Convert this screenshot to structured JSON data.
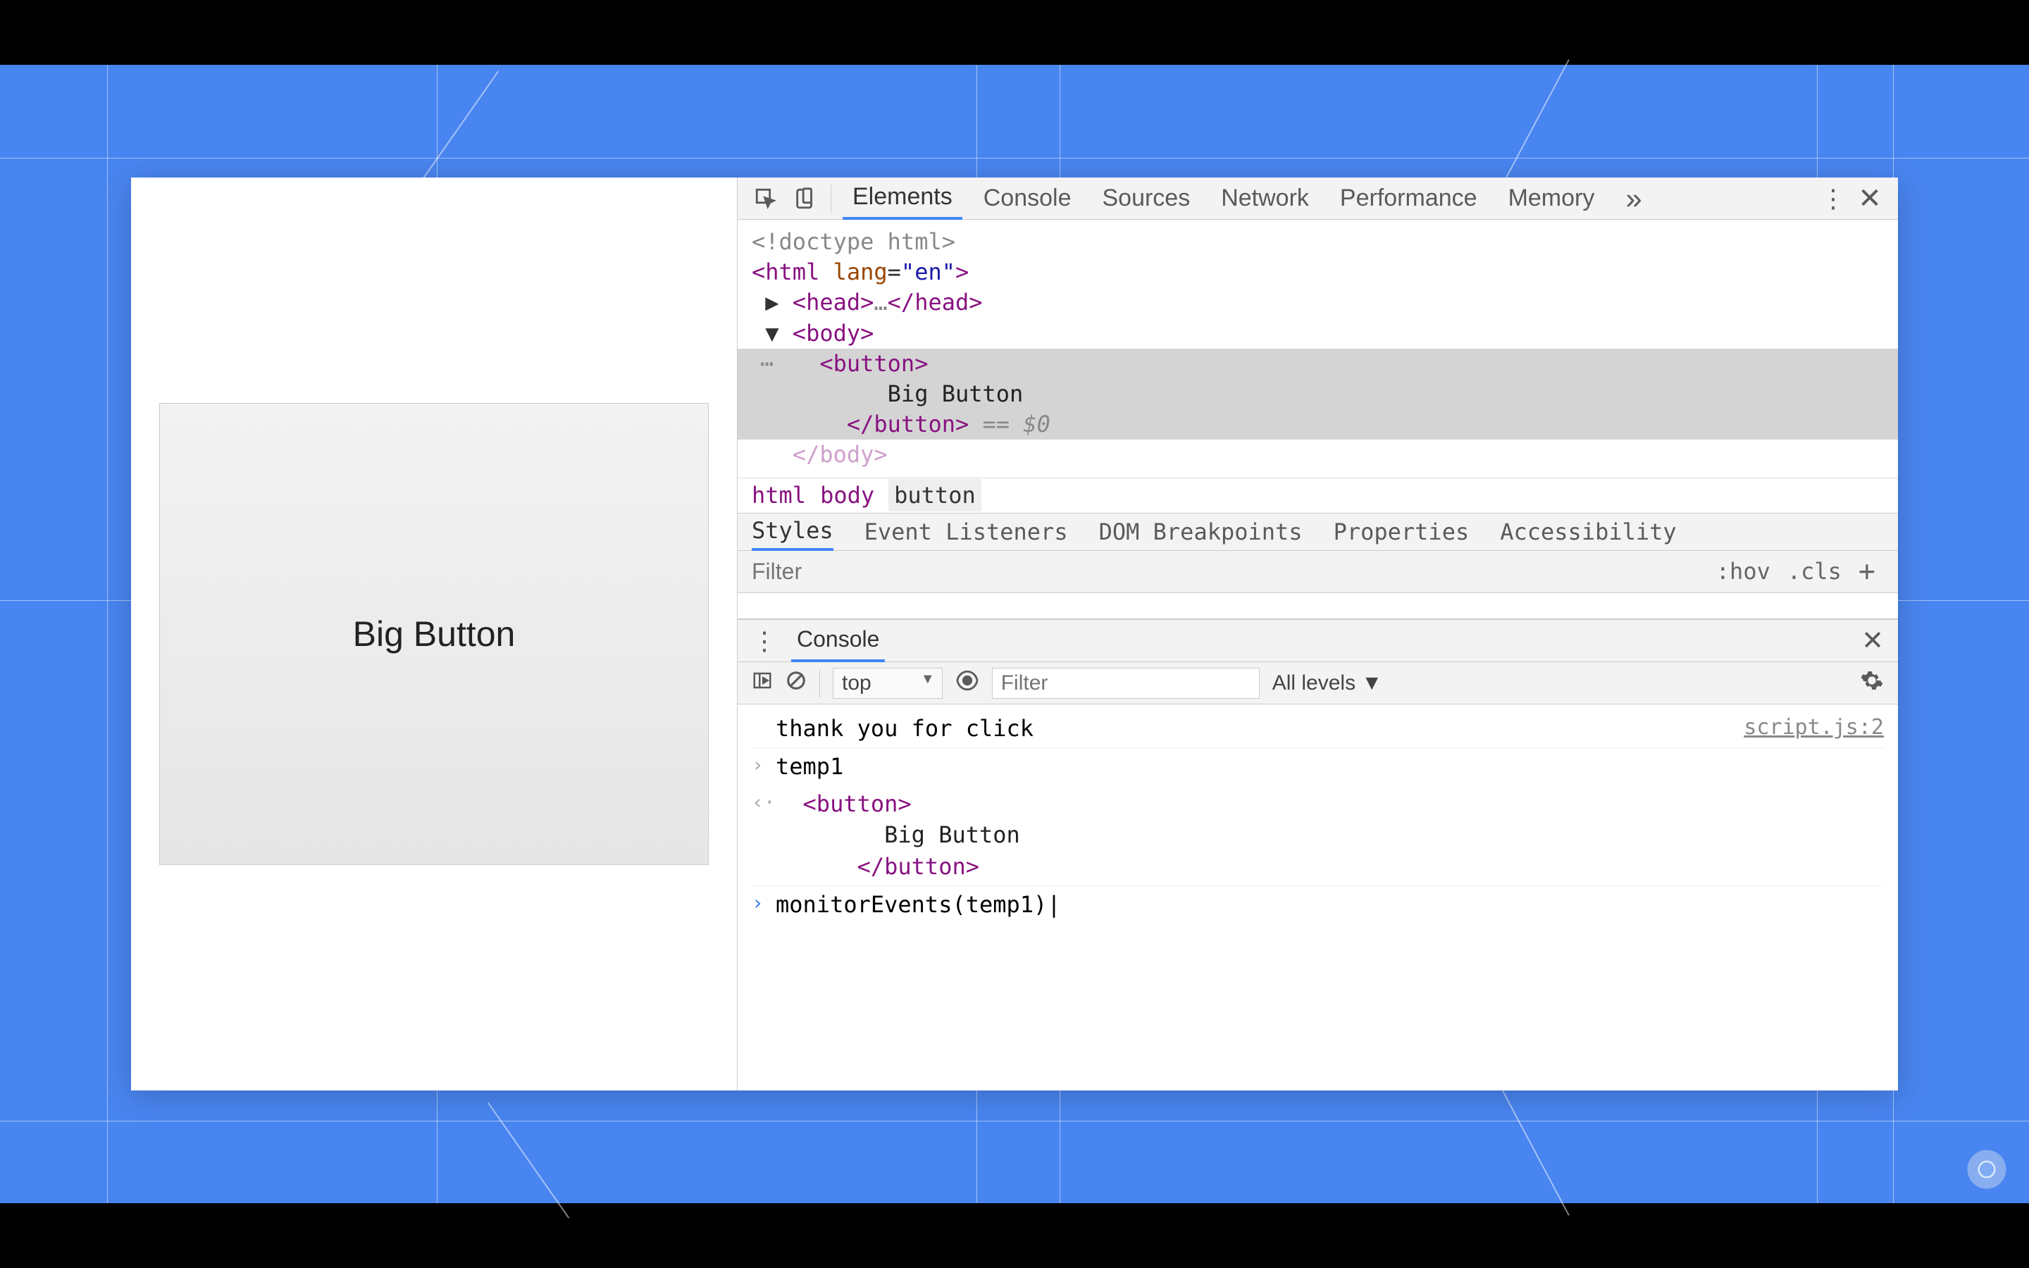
{
  "preview": {
    "button_label": "Big Button"
  },
  "devtools": {
    "tabs": [
      "Elements",
      "Console",
      "Sources",
      "Network",
      "Performance",
      "Memory"
    ],
    "active_tab": "Elements",
    "dom": {
      "doctype": "<!doctype html>",
      "html_open": "<html lang=\"en\">",
      "head": "<head>…</head>",
      "body_open": "<body>",
      "button_open": "<button>",
      "button_text": "Big Button",
      "button_close": "</button>",
      "eq0": "== $0",
      "body_close": "</body>"
    },
    "breadcrumbs": [
      "html",
      "body",
      "button"
    ],
    "styles_tabs": [
      "Styles",
      "Event Listeners",
      "DOM Breakpoints",
      "Properties",
      "Accessibility"
    ],
    "styles_filter_placeholder": "Filter",
    "hov_label": ":hov",
    "cls_label": ".cls",
    "plus_label": "+"
  },
  "console": {
    "tab_label": "Console",
    "context": "top",
    "filter_placeholder": "Filter",
    "levels_label": "All levels ▼",
    "log_message": "thank you for click",
    "log_source": "script.js:2",
    "input1": "temp1",
    "output_button_open": "<button>",
    "output_button_text": "Big Button",
    "output_button_close": "</button>",
    "input2": "monitorEvents(temp1)"
  }
}
